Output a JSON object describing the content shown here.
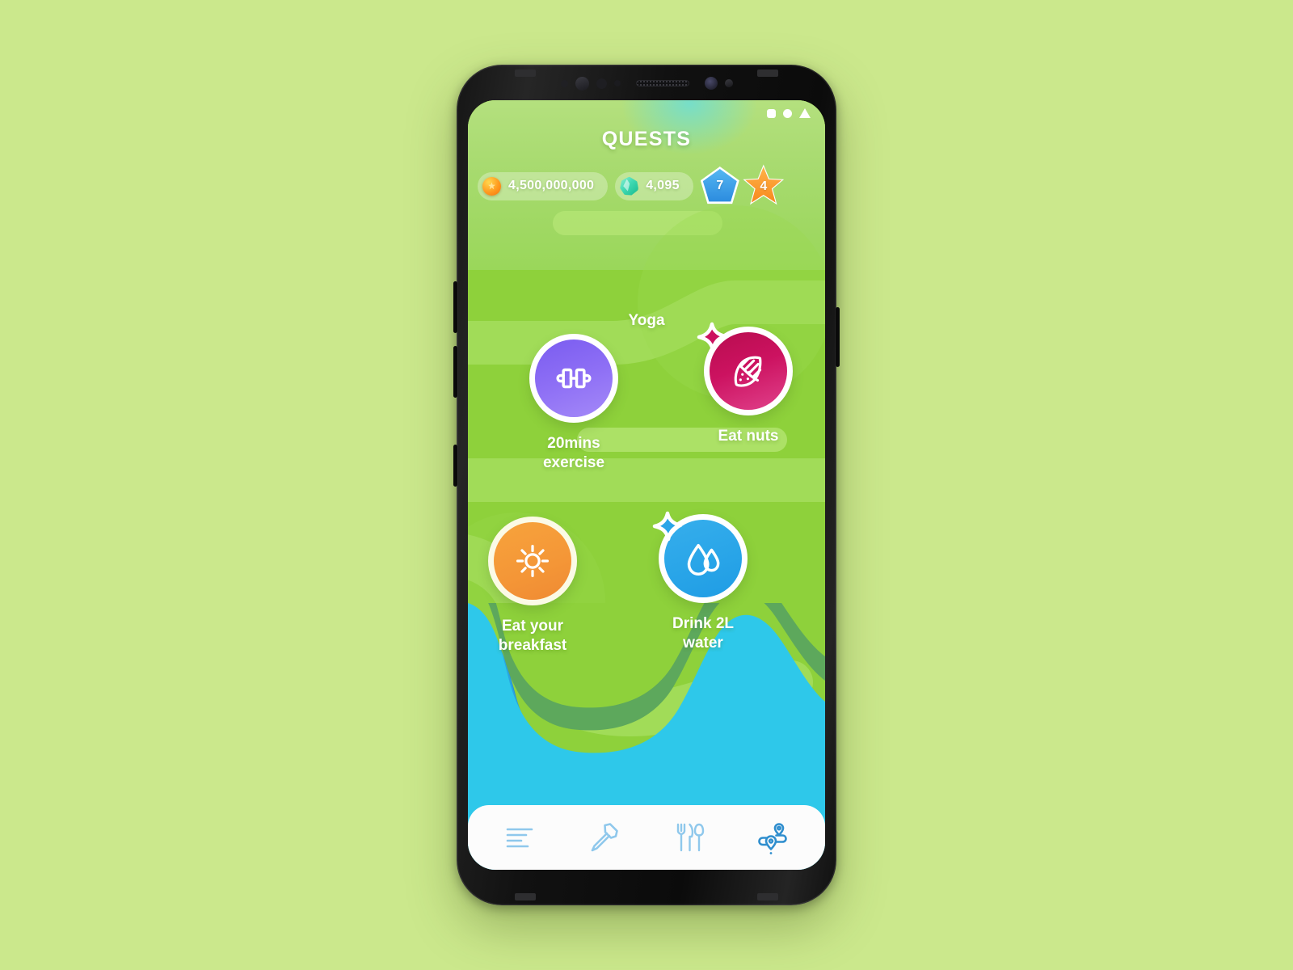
{
  "app": {
    "screen_title": "QUESTS"
  },
  "status_bar": {
    "icons": [
      "square-icon",
      "circle-icon",
      "triangle-icon"
    ]
  },
  "resources": {
    "coins": {
      "icon": "coin-icon",
      "amount": "4,500,000,000"
    },
    "gems": {
      "icon": "gem-icon",
      "amount": "4,095"
    },
    "level_badge": {
      "icon": "pentagon-badge-icon",
      "value": "7",
      "color": "#2b8fe0"
    },
    "star_badge": {
      "icon": "star-badge-icon",
      "value": "4",
      "color": "#f7861a"
    }
  },
  "quest_map": {
    "partial_label_above": "Yoga",
    "nodes": [
      {
        "id": "exercise",
        "label": "20mins\nexercise",
        "label_line1": "20mins",
        "label_line2": "exercise",
        "icon": "dumbbell-icon",
        "color": "#8e6ff5",
        "has_sparkle": false
      },
      {
        "id": "nuts",
        "label": "Eat nuts",
        "label_line1": "Eat nuts",
        "label_line2": "",
        "icon": "almond-nut-icon",
        "color": "#cc1260",
        "has_sparkle": true,
        "sparkle_color": "#cc1260"
      },
      {
        "id": "breakfast",
        "label": "Eat your\nbreakfast",
        "label_line1": "Eat your",
        "label_line2": "breakfast",
        "icon": "sun-icon",
        "color": "#f49637",
        "has_sparkle": false
      },
      {
        "id": "water",
        "label": "Drink 2L\nwater",
        "label_line1": "Drink 2L",
        "label_line2": "water",
        "icon": "water-drops-icon",
        "color": "#29a5e8",
        "has_sparkle": true,
        "sparkle_color": "#29a5e8"
      }
    ]
  },
  "bottom_nav": {
    "items": [
      {
        "id": "feed",
        "icon": "list-lines-icon",
        "active": false
      },
      {
        "id": "build",
        "icon": "hammer-icon",
        "active": false
      },
      {
        "id": "food",
        "icon": "cutlery-icon",
        "active": false
      },
      {
        "id": "journey",
        "icon": "route-pins-icon",
        "active": true
      }
    ]
  },
  "theme": {
    "page_background": "#cbe88c",
    "land_green": "#8ed13b",
    "shore_green": "#5da85c",
    "shallow_water": "#2ec8ea",
    "mid_water": "#29a5e0",
    "deep_water": "#2b8ccd",
    "nav_inactive": "#8fc8ec",
    "nav_active": "#2f8ece"
  }
}
